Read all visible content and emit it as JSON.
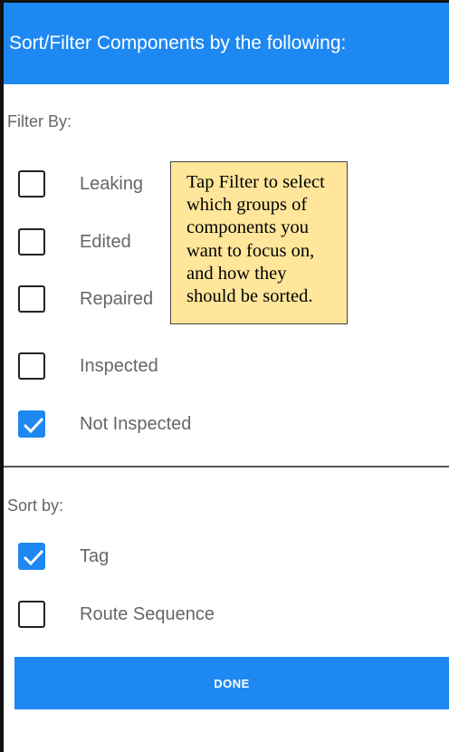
{
  "header": {
    "title": "Sort/Filter Components by the following:"
  },
  "filter": {
    "label": "Filter By:",
    "items": [
      {
        "label": "Leaking",
        "checked": false
      },
      {
        "label": "Edited",
        "checked": false
      },
      {
        "label": "Repaired",
        "checked": false
      },
      {
        "label": "Inspected",
        "checked": false
      },
      {
        "label": "Not Inspected",
        "checked": true
      }
    ]
  },
  "sort": {
    "label": "Sort by:",
    "items": [
      {
        "label": "Tag",
        "checked": true
      },
      {
        "label": "Route Sequence",
        "checked": false
      }
    ]
  },
  "done_button": {
    "label": "DONE"
  },
  "tooltip": {
    "text": "Tap Filter to select which groups of components you want to focus on, and how they should be sorted."
  },
  "colors": {
    "accent": "#1e88f2",
    "tooltip_bg": "#ffe69a"
  }
}
